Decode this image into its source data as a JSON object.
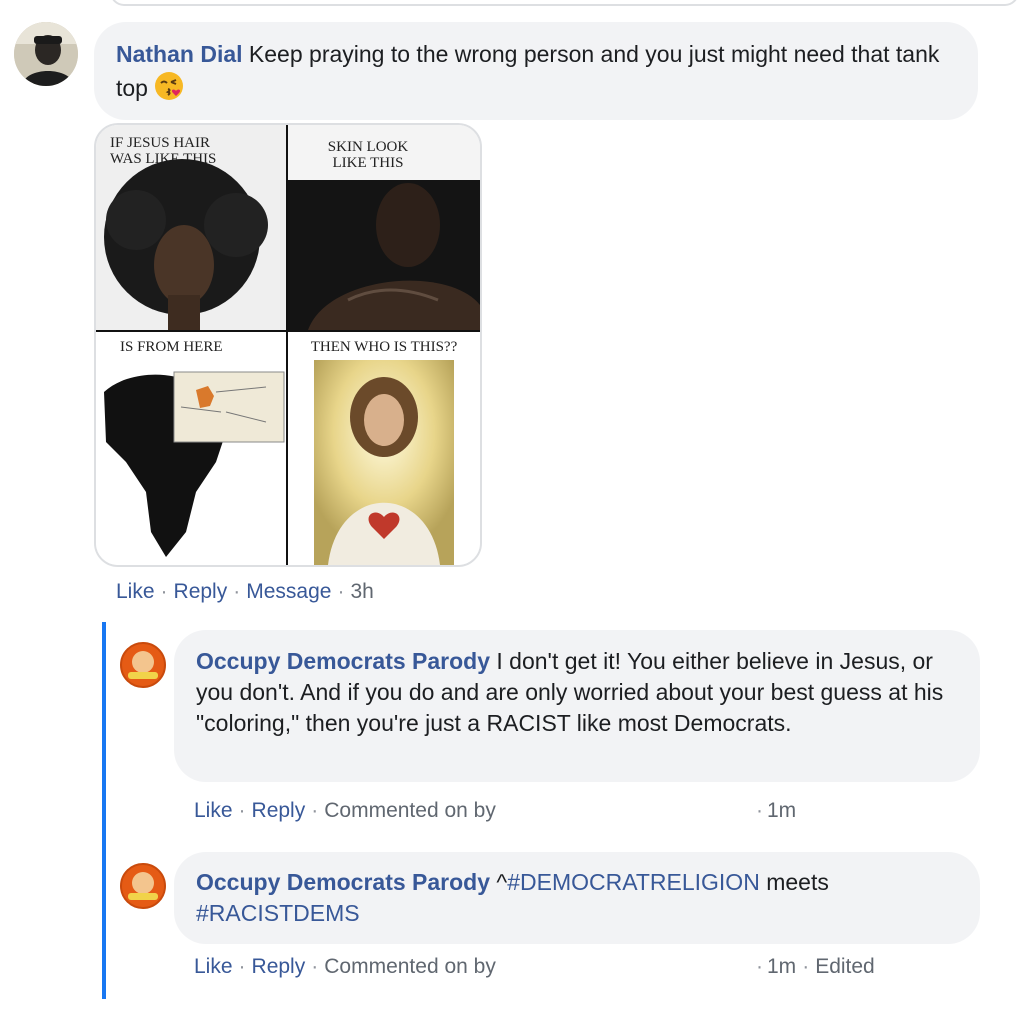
{
  "comment": {
    "author": "Nathan Dial",
    "text": "Keep praying to the wrong person and you just might need that tank top",
    "emoji": "face-blowing-kiss",
    "image_captions": {
      "top_left": "IF JESUS HAIR WAS LIKE THIS",
      "top_right": "SKIN LOOK LIKE THIS",
      "bottom_left": "IS FROM HERE",
      "bottom_right": "THEN WHO IS THIS??"
    },
    "actions": {
      "like": "Like",
      "reply": "Reply",
      "message": "Message",
      "time": "3h"
    }
  },
  "replies": [
    {
      "author": "Occupy Democrats Parody",
      "text": "I don't get it! You either believe in Jesus, or you don't. And if you do and are only worried about your best guess at his \"coloring,\" then you're just a RACIST like most Democrats.",
      "like": "Like",
      "reply": "Reply",
      "commented_on": "Commented on by",
      "time": "1m"
    },
    {
      "author": "Occupy Democrats Parody",
      "prefix": "^",
      "hashtag1": "#DEMOCRATRELIGION",
      "middle": " meets",
      "hashtag2": "#RACISTDEMS",
      "like": "Like",
      "reply": "Reply",
      "commented_on": "Commented on by",
      "time": "1m",
      "edited": "Edited"
    }
  ],
  "colors": {
    "link": "#385898",
    "bubble": "#f2f3f5",
    "thread_bar": "#1877f2",
    "meta": "#606770"
  }
}
